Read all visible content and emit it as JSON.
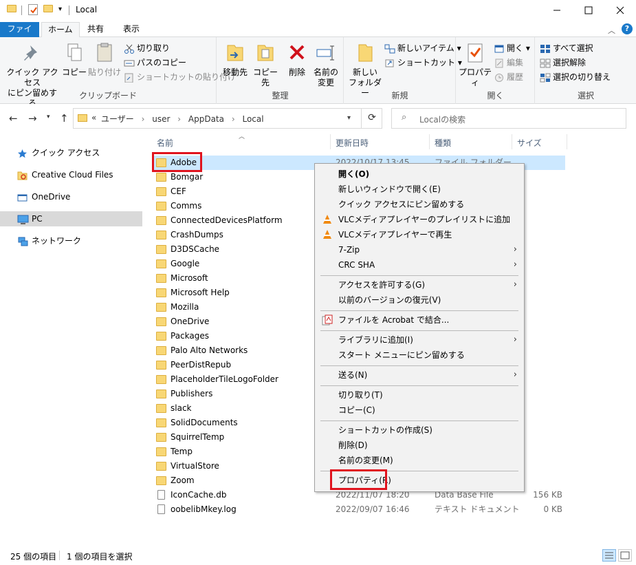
{
  "window": {
    "title": "Local",
    "minimize_icon": "minimize-icon",
    "maximize_icon": "maximize-icon",
    "close_icon": "close-icon"
  },
  "ribbon_tabs": [
    "ファイル",
    "ホーム",
    "共有",
    "表示"
  ],
  "ribbon": {
    "clipboard": {
      "label": "クリップボード",
      "pin_quick_access": [
        "クイック アクセス",
        "にピン留めする"
      ],
      "copy": "コピー",
      "paste": "貼り付け",
      "cut": "切り取り",
      "copy_path": "パスのコピー",
      "paste_shortcut": "ショートカットの貼り付け"
    },
    "organize": {
      "label": "整理",
      "move_to": "移動先",
      "copy_to": "コピー先",
      "delete": "削除",
      "rename": [
        "名前の",
        "変更"
      ]
    },
    "new": {
      "label": "新規",
      "new_folder": [
        "新しい",
        "フォルダー"
      ],
      "new_item": "新しいアイテム",
      "easy_access": "ショートカット"
    },
    "open": {
      "label": "開く",
      "properties": "プロパティ",
      "open": "開く",
      "edit": "編集",
      "history": "履歴"
    },
    "select": {
      "label": "選択",
      "select_all": "すべて選択",
      "select_none": "選択解除",
      "invert": "選択の切り替え"
    }
  },
  "address": {
    "overflow": "«",
    "crumbs": [
      "ユーザー",
      "user",
      "AppData",
      "Local"
    ],
    "separator": "›",
    "search_placeholder": "Localの検索"
  },
  "navpane": [
    {
      "label": "クイック アクセス",
      "icon": "star-icon"
    },
    {
      "label": "Creative Cloud Files",
      "icon": "creative-cloud-icon"
    },
    {
      "label": "OneDrive",
      "icon": "onedrive-icon"
    },
    {
      "label": "PC",
      "icon": "pc-icon"
    },
    {
      "label": "ネットワーク",
      "icon": "network-icon"
    }
  ],
  "columns": {
    "name": "名前",
    "date": "更新日時",
    "type": "種類",
    "size": "サイズ"
  },
  "files": [
    {
      "name": "Adobe",
      "date": "2022/10/17 13:45",
      "type": "ファイル フォルダー",
      "size": ""
    },
    {
      "name": "Bomgar",
      "date": "",
      "type": "",
      "size": ""
    },
    {
      "name": "CEF",
      "date": "",
      "type": "",
      "size": ""
    },
    {
      "name": "Comms",
      "date": "",
      "type": "",
      "size": ""
    },
    {
      "name": "ConnectedDevicesPlatform",
      "date": "",
      "type": "",
      "size": ""
    },
    {
      "name": "CrashDumps",
      "date": "",
      "type": "",
      "size": ""
    },
    {
      "name": "D3DSCache",
      "date": "",
      "type": "",
      "size": ""
    },
    {
      "name": "Google",
      "date": "",
      "type": "",
      "size": ""
    },
    {
      "name": "Microsoft",
      "date": "",
      "type": "",
      "size": ""
    },
    {
      "name": "Microsoft Help",
      "date": "",
      "type": "",
      "size": ""
    },
    {
      "name": "Mozilla",
      "date": "",
      "type": "",
      "size": ""
    },
    {
      "name": "OneDrive",
      "date": "",
      "type": "",
      "size": ""
    },
    {
      "name": "Packages",
      "date": "",
      "type": "",
      "size": ""
    },
    {
      "name": "Palo Alto Networks",
      "date": "",
      "type": "",
      "size": ""
    },
    {
      "name": "PeerDistRepub",
      "date": "",
      "type": "",
      "size": ""
    },
    {
      "name": "PlaceholderTileLogoFolder",
      "date": "",
      "type": "",
      "size": ""
    },
    {
      "name": "Publishers",
      "date": "",
      "type": "",
      "size": ""
    },
    {
      "name": "slack",
      "date": "",
      "type": "",
      "size": ""
    },
    {
      "name": "SolidDocuments",
      "date": "",
      "type": "",
      "size": ""
    },
    {
      "name": "SquirrelTemp",
      "date": "",
      "type": "",
      "size": ""
    },
    {
      "name": "Temp",
      "date": "",
      "type": "",
      "size": ""
    },
    {
      "name": "VirtualStore",
      "date": "",
      "type": "",
      "size": ""
    },
    {
      "name": "Zoom",
      "date": "",
      "type": "",
      "size": ""
    },
    {
      "name": "IconCache.db",
      "date": "2022/11/07 18:20",
      "type": "Data Base File",
      "size": "156 KB"
    },
    {
      "name": "oobelibMkey.log",
      "date": "2022/09/07 16:46",
      "type": "テキスト ドキュメント",
      "size": "0 KB"
    }
  ],
  "context_menu": {
    "open": "開く(O)",
    "open_new_window": "新しいウィンドウで開く(E)",
    "pin_quick_access": "クイック アクセスにピン留めする",
    "vlc_playlist": "VLCメディアプレイヤーのプレイリストに追加",
    "vlc_play": "VLCメディアプレイヤーで再生",
    "seven_zip": "7-Zip",
    "crc_sha": "CRC SHA",
    "give_access": "アクセスを許可する(G)",
    "restore_versions": "以前のバージョンの復元(V)",
    "acrobat_combine": "ファイルを Acrobat で結合...",
    "include_library": "ライブラリに追加(I)",
    "pin_start": "スタート メニューにピン留めする",
    "send_to": "送る(N)",
    "cut": "切り取り(T)",
    "copy": "コピー(C)",
    "create_shortcut": "ショートカットの作成(S)",
    "delete": "削除(D)",
    "rename": "名前の変更(M)",
    "properties": "プロパティ(R)"
  },
  "status": {
    "item_count": "25 個の項目",
    "selected": "1 個の項目を選択"
  },
  "colors": {
    "accent": "#1979ca",
    "selection": "#cce8ff",
    "highlight_box": "#e0141e",
    "folder": "#f8d775"
  }
}
